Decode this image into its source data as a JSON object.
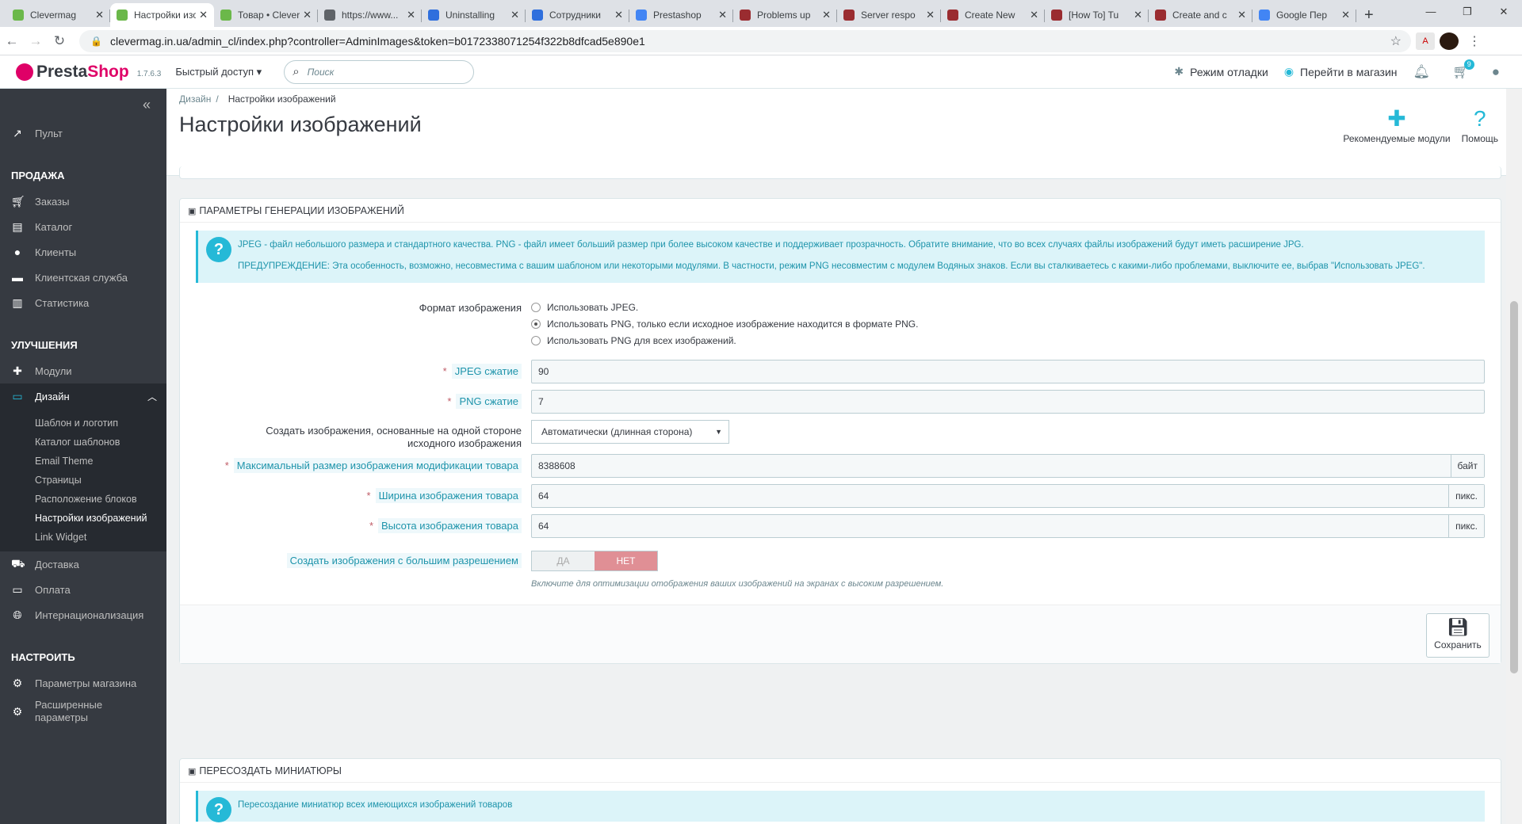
{
  "browser": {
    "tabs": [
      {
        "title": "Clevermag",
        "color": "#6bb84a"
      },
      {
        "title": "Настройки изображений",
        "color": "#6bb84a"
      },
      {
        "title": "Товар • Clevermag",
        "color": "#6bb84a"
      },
      {
        "title": "https://www...",
        "color": "#5f6368"
      },
      {
        "title": "Uninstalling",
        "color": "#2f6fdd"
      },
      {
        "title": "Сотрудники",
        "color": "#2f6fdd"
      },
      {
        "title": "Prestashop",
        "color": "#4285f4"
      },
      {
        "title": "Problems up",
        "color": "#9a2c30"
      },
      {
        "title": "Server respo",
        "color": "#9a2c30"
      },
      {
        "title": "Create New",
        "color": "#9a2c30"
      },
      {
        "title": "[How To] Tu",
        "color": "#9a2c30"
      },
      {
        "title": "Create and c",
        "color": "#9a2c30"
      },
      {
        "title": "Google Пер",
        "color": "#4285f4"
      }
    ],
    "url": "clevermag.in.ua/admin_cl/index.php?controller=AdminImages&token=b0172338071254f322b8dfcad5e890e1",
    "pdf_ext": "A"
  },
  "top": {
    "logo_presta": "Presta",
    "logo_shop": "Shop",
    "version": "1.7.6.3",
    "quick_access": "Быстрый доступ ▾",
    "search_placeholder": "Поиск",
    "debug_mode": "Режим отладки",
    "visit_shop": "Перейти в магазин",
    "cart_badge": "9"
  },
  "sidebar": {
    "dashboard": "Пульт",
    "sell_title": "ПРОДАЖА",
    "sell": [
      "Заказы",
      "Каталог",
      "Клиенты",
      "Клиентская служба",
      "Статистика"
    ],
    "improve_title": "УЛУЧШЕНИЯ",
    "modules": "Модули",
    "design": "Дизайн",
    "design_sub": [
      "Шаблон и логотип",
      "Каталог шаблонов",
      "Email Theme",
      "Страницы",
      "Расположение блоков",
      "Настройки изображений",
      "Link Widget"
    ],
    "shipping": "Доставка",
    "payment": "Оплата",
    "international": "Интернационализация",
    "configure_title": "НАСТРОИТЬ",
    "shop_params": "Параметры магазина",
    "advanced_params_1": "Расширенные",
    "advanced_params_2": "параметры"
  },
  "header": {
    "breadcrumb_parent": "Дизайн",
    "breadcrumb_sep": "/",
    "breadcrumb_current": "Настройки изображений",
    "title": "Настройки изображений",
    "recommended_modules": "Рекомендуемые модули",
    "help": "Помощь"
  },
  "panel1": {
    "title": "ПАРАМЕТРЫ ГЕНЕРАЦИИ ИЗОБРАЖЕНИЙ",
    "info1": "JPEG - файл небольшого размера и стандартного качества. PNG - файл имеет больший размер при более высоком качестве и поддерживает прозрачность. Обратите внимание, что во всех случаях файлы изображений будут иметь расширение JPG.",
    "info2": "ПРЕДУПРЕЖДЕНИЕ: Эта особенность, возможно, несовместима с вашим шаблоном или некоторыми модулями. В частности, режим PNG несовместим с модулем Водяных знаков. Если вы сталкиваетесь с какими-либо проблемами, выключите ее, выбрав \"Использовать JPEG\".",
    "format_label": "Формат изображения",
    "format_options": [
      "Использовать JPEG.",
      "Использовать PNG, только если исходное изображение находится в формате PNG.",
      "Использовать PNG для всех изображений."
    ],
    "format_selected": 1,
    "jpeg_label": "JPEG сжатие",
    "jpeg_value": "90",
    "png_label": "PNG сжатие",
    "png_value": "7",
    "side_label_1": "Создать изображения, основанные на одной стороне",
    "side_label_2": "исходного изображения",
    "side_value": "Автоматически (длинная сторона)",
    "max_size_label": "Максимальный размер изображения модификации товара",
    "max_size_value": "8388608",
    "max_size_unit": "байт",
    "width_label": "Ширина изображения товара",
    "width_value": "64",
    "width_unit": "пикс.",
    "height_label": "Высота изображения товара",
    "height_value": "64",
    "height_unit": "пикс.",
    "hires_label": "Создать изображения с большим разрешением",
    "hires_yes": "ДА",
    "hires_no": "НЕТ",
    "hires_help": "Включите для оптимизации отображения ваших изображений на экранах с высоким разрешением.",
    "save": "Сохранить"
  },
  "panel2": {
    "title": "ПЕРЕСОЗДАТЬ МИНИАТЮРЫ",
    "info": "Пересоздание миниатюр всех имеющихся изображений товаров"
  }
}
